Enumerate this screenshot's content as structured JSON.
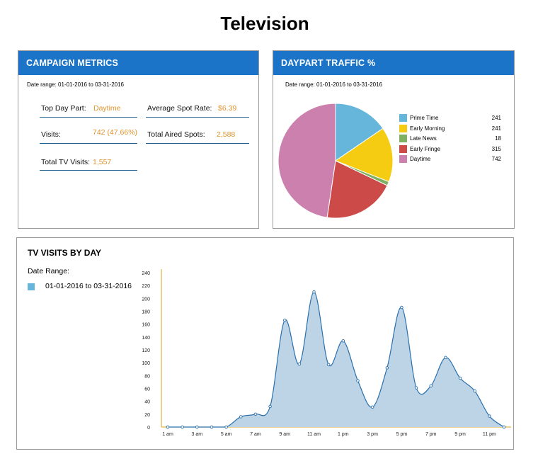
{
  "page_title": "Television",
  "campaign_metrics": {
    "header": "CAMPAIGN METRICS",
    "date_range": "Date range: 01-01-2016 to 03-31-2016",
    "top_day_part_label": "Top Day Part:",
    "top_day_part_value": "Daytime",
    "average_spot_rate_label": "Average Spot Rate:",
    "average_spot_rate_value": "$6.39",
    "visits_label": "Visits:",
    "visits_value": "742 (47.66%)",
    "total_aired_spots_label": "Total Aired Spots:",
    "total_aired_spots_value": "2,588",
    "total_tv_visits_label": "Total TV Visits:",
    "total_tv_visits_value": "1,557",
    "value_color": "#e0922c"
  },
  "daypart_traffic": {
    "header": "DAYPART TRAFFIC %",
    "date_range": "Date range: 01-01-2016 to 03-31-2016"
  },
  "tv_visits": {
    "header": "TV VISITS BY DAY",
    "date_range_label": "Date Range:",
    "legend_label": "01-01-2016 to 03-31-2016"
  },
  "chart_data": [
    {
      "type": "pie",
      "slices": [
        {
          "label": "Prime Time",
          "value": 241,
          "color": "#66b6dc"
        },
        {
          "label": "Early Morning",
          "value": 241,
          "color": "#f5cc12"
        },
        {
          "label": "Late News",
          "value": 18,
          "color": "#7eb161"
        },
        {
          "label": "Early Fringe",
          "value": 315,
          "color": "#cc4a48"
        },
        {
          "label": "Daytime",
          "value": 742,
          "color": "#cc80ae"
        }
      ],
      "legend_position": "right"
    },
    {
      "type": "area",
      "x": [
        "1 am",
        "2 am",
        "3 am",
        "4 am",
        "5 am",
        "6 am",
        "7 am",
        "8 am",
        "9 am",
        "10 am",
        "11 am",
        "12 pm",
        "1 pm",
        "2 pm",
        "3 pm",
        "4 pm",
        "5 pm",
        "6 pm",
        "7 pm",
        "8 pm",
        "9 pm",
        "10 pm",
        "11 pm",
        "12 am"
      ],
      "x_tick_labels": [
        "1 am",
        "3 am",
        "5 am",
        "7 am",
        "9 am",
        "11 am",
        "1 pm",
        "3 pm",
        "5 pm",
        "7 pm",
        "9 pm",
        "11 pm"
      ],
      "series": [
        {
          "name": "01-01-2016 to 03-31-2016",
          "values": [
            0,
            0,
            0,
            0,
            0,
            16,
            20,
            32,
            166,
            98,
            210,
            97,
            134,
            72,
            31,
            92,
            186,
            61,
            64,
            108,
            76,
            56,
            17,
            0
          ],
          "fill_color": "#bdd4e6",
          "line_color": "#2a70ac"
        }
      ],
      "y_ticks": [
        0,
        20,
        40,
        60,
        80,
        100,
        120,
        140,
        160,
        180,
        200,
        220,
        240
      ],
      "ylim": [
        0,
        240
      ],
      "axis_color": "#d4a31c",
      "grid": false
    }
  ]
}
